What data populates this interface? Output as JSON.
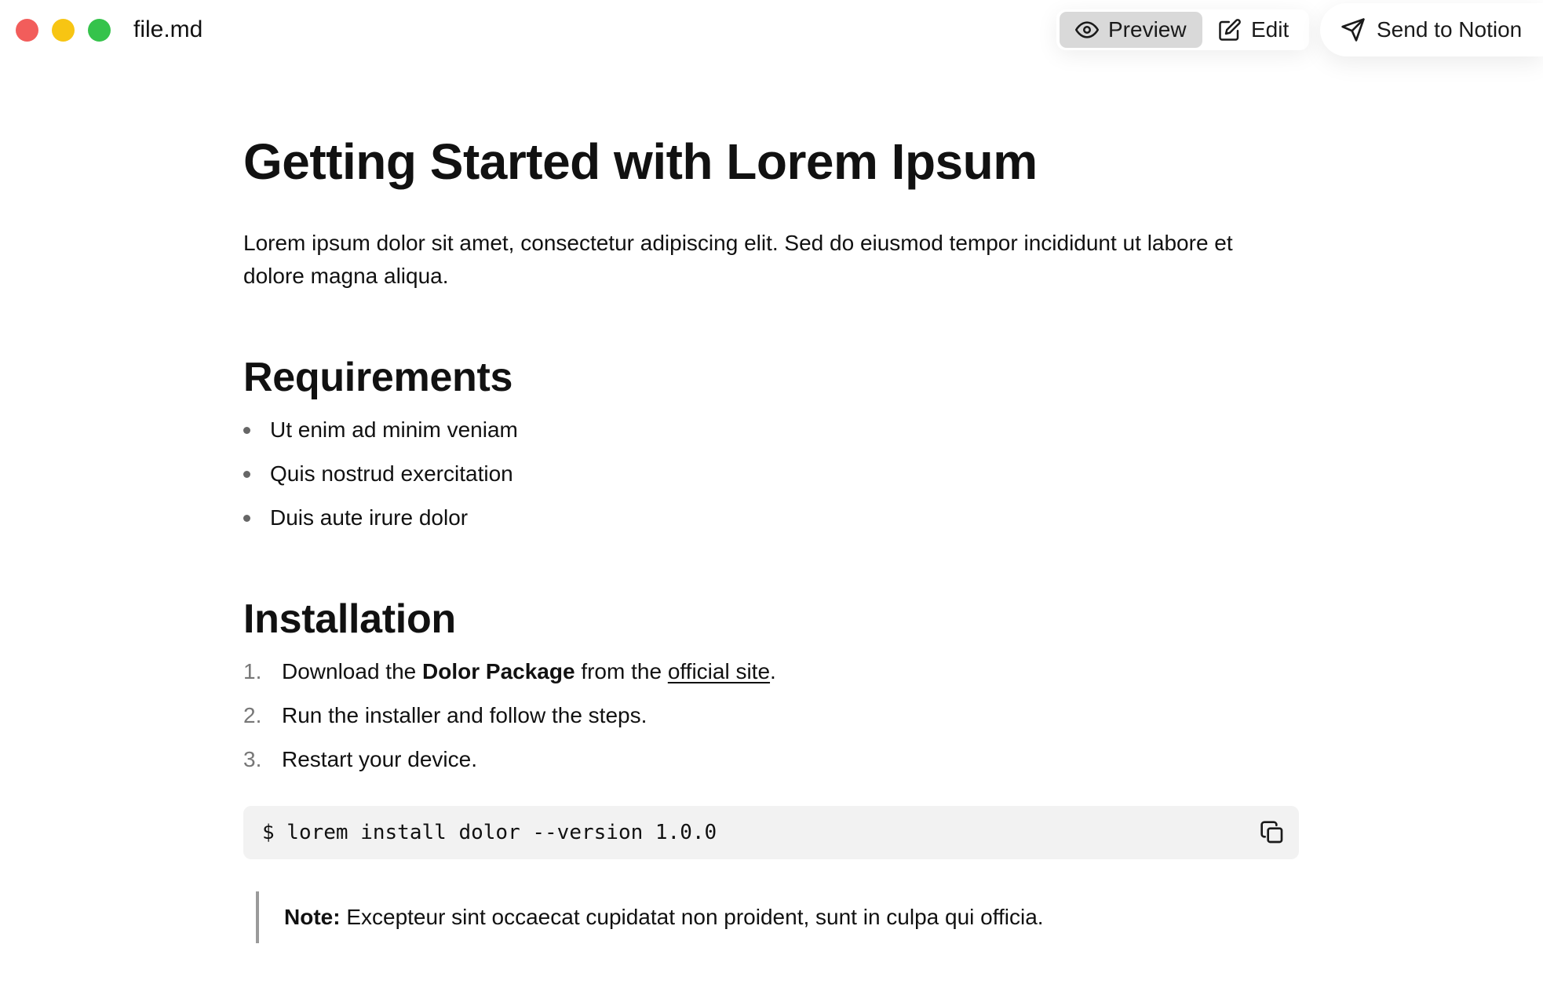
{
  "window": {
    "filename": "file.md"
  },
  "toolbar": {
    "preview_label": "Preview",
    "edit_label": "Edit",
    "send_label": "Send to Notion",
    "active_mode": "Preview"
  },
  "document": {
    "title": "Getting Started with Lorem Ipsum",
    "intro": "Lorem ipsum dolor sit amet, consectetur adipiscing elit. Sed do eiusmod tempor incididunt ut labore et dolore magna aliqua.",
    "requirements": {
      "heading": "Requirements",
      "items": [
        "Ut enim ad minim veniam",
        "Quis nostrud exercitation",
        "Duis aute irure dolor"
      ]
    },
    "installation": {
      "heading": "Installation",
      "steps": [
        {
          "number": "1.",
          "before": "Download the ",
          "bold": "Dolor Package",
          "middle": " from the ",
          "link": "official site",
          "after": "."
        },
        {
          "number": "2.",
          "text": "Run the installer and follow the steps."
        },
        {
          "number": "3.",
          "text": "Restart your device."
        }
      ],
      "code": "$ lorem install dolor --version 1.0.0"
    },
    "note": {
      "label": "Note:",
      "text": " Excepteur sint occaecat cupidatat non proident, sunt in culpa qui officia."
    }
  },
  "colors": {
    "close": "#f25d5b",
    "minimize": "#f7c513",
    "zoom": "#35c34b",
    "active_toggle": "#d9d9d9",
    "code_background": "#f2f2f2"
  },
  "icons": {
    "preview": "eye-icon",
    "edit": "pencil-square-icon",
    "send": "paper-plane-icon",
    "copy": "copy-icon"
  }
}
